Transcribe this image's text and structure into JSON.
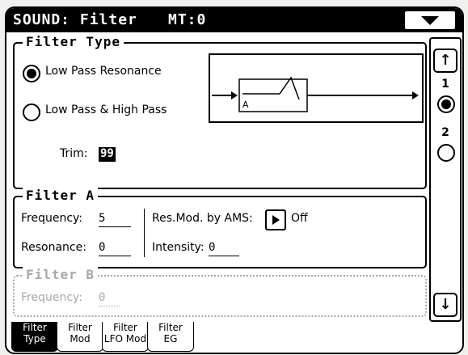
{
  "header": {
    "title": "SOUND: Filter",
    "mt_label": "MT:0",
    "menu_icon": "menu-triangle-icon"
  },
  "filter_type": {
    "title": "Filter Type",
    "options": [
      {
        "label": "Low Pass Resonance",
        "selected": true
      },
      {
        "label": "Low Pass & High Pass",
        "selected": false
      }
    ],
    "diagram_label": "A",
    "trim_label": "Trim:",
    "trim_value": "99"
  },
  "filter_a": {
    "title": "Filter A",
    "frequency_label": "Frequency:",
    "frequency_value": "5",
    "resonance_label": "Resonance:",
    "resonance_value": "0",
    "res_mod_label": "Res.Mod. by AMS:",
    "res_mod_value": "Off",
    "intensity_label": "Intensity:",
    "intensity_value": "0"
  },
  "filter_b": {
    "title": "Filter B",
    "frequency_label": "Frequency:",
    "frequency_value": "0"
  },
  "pager": {
    "up_icon": "arrow-up-icon",
    "down_icon": "arrow-down-icon",
    "pages": [
      {
        "label": "1",
        "selected": true
      },
      {
        "label": "2",
        "selected": false
      }
    ]
  },
  "tabs": [
    {
      "line1": "Filter",
      "line2": "Type",
      "active": true
    },
    {
      "line1": "Filter",
      "line2": "Mod",
      "active": false
    },
    {
      "line1": "Filter",
      "line2": "LFO Mod",
      "active": false
    },
    {
      "line1": "Filter",
      "line2": "EG",
      "active": false
    }
  ]
}
